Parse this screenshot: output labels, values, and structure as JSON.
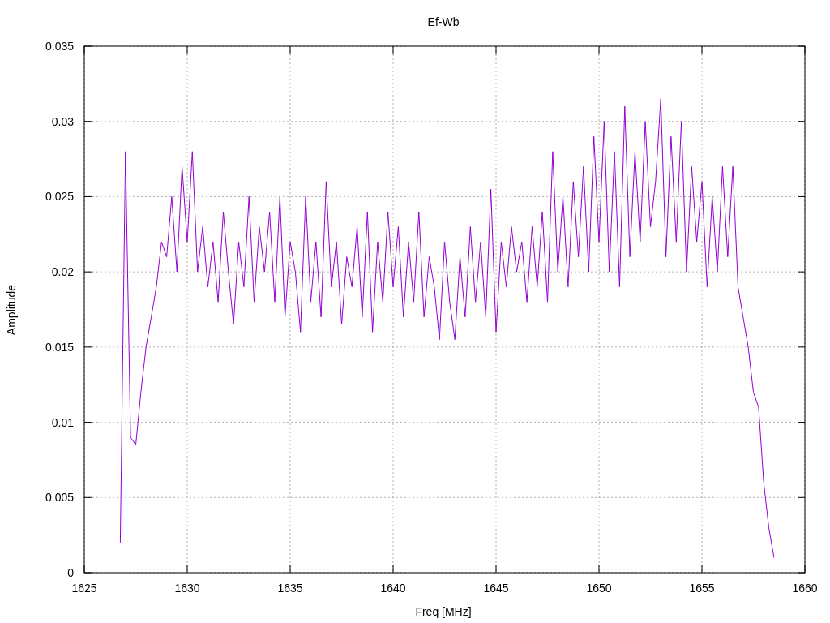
{
  "chart_data": {
    "type": "line",
    "title": "Ef-Wb",
    "xlabel": "Freq [MHz]",
    "ylabel": "Amplitude",
    "xlim": [
      1625,
      1660
    ],
    "ylim": [
      0,
      0.035
    ],
    "xticks": [
      1625,
      1630,
      1635,
      1640,
      1645,
      1650,
      1655,
      1660
    ],
    "yticks": [
      0,
      0.005,
      0.01,
      0.015,
      0.02,
      0.025,
      0.03,
      0.035
    ],
    "x": [
      1626.75,
      1627,
      1627.25,
      1627.5,
      1627.75,
      1628,
      1628.25,
      1628.5,
      1628.75,
      1629,
      1629.25,
      1629.5,
      1629.75,
      1630,
      1630.25,
      1630.5,
      1630.75,
      1631,
      1631.25,
      1631.5,
      1631.75,
      1632,
      1632.25,
      1632.5,
      1632.75,
      1633,
      1633.25,
      1633.5,
      1633.75,
      1634,
      1634.25,
      1634.5,
      1634.75,
      1635,
      1635.25,
      1635.5,
      1635.75,
      1636,
      1636.25,
      1636.5,
      1636.75,
      1637,
      1637.25,
      1637.5,
      1637.75,
      1638,
      1638.25,
      1638.5,
      1638.75,
      1639,
      1639.25,
      1639.5,
      1639.75,
      1640,
      1640.25,
      1640.5,
      1640.75,
      1641,
      1641.25,
      1641.5,
      1641.75,
      1642,
      1642.25,
      1642.5,
      1642.75,
      1643,
      1643.25,
      1643.5,
      1643.75,
      1644,
      1644.25,
      1644.5,
      1644.75,
      1645,
      1645.25,
      1645.5,
      1645.75,
      1646,
      1646.25,
      1646.5,
      1646.75,
      1647,
      1647.25,
      1647.5,
      1647.75,
      1648,
      1648.25,
      1648.5,
      1648.75,
      1649,
      1649.25,
      1649.5,
      1649.75,
      1650,
      1650.25,
      1650.5,
      1650.75,
      1651,
      1651.25,
      1651.5,
      1651.75,
      1652,
      1652.25,
      1652.5,
      1652.75,
      1653,
      1653.25,
      1653.5,
      1653.75,
      1654,
      1654.25,
      1654.5,
      1654.75,
      1655,
      1655.25,
      1655.5,
      1655.75,
      1656,
      1656.25,
      1656.5,
      1656.75,
      1657,
      1657.25,
      1657.5,
      1657.75,
      1658,
      1658.25,
      1658.5
    ],
    "grid": true,
    "series": [
      {
        "color": "#9400d3",
        "values": [
          0.002,
          0.028,
          0.009,
          0.0085,
          0.012,
          0.015,
          0.017,
          0.019,
          0.022,
          0.021,
          0.025,
          0.02,
          0.027,
          0.022,
          0.028,
          0.02,
          0.023,
          0.019,
          0.022,
          0.018,
          0.024,
          0.02,
          0.0165,
          0.022,
          0.019,
          0.025,
          0.018,
          0.023,
          0.02,
          0.024,
          0.018,
          0.025,
          0.017,
          0.022,
          0.02,
          0.016,
          0.025,
          0.018,
          0.022,
          0.017,
          0.026,
          0.019,
          0.022,
          0.0165,
          0.021,
          0.019,
          0.023,
          0.017,
          0.024,
          0.016,
          0.022,
          0.018,
          0.024,
          0.019,
          0.023,
          0.017,
          0.022,
          0.018,
          0.024,
          0.017,
          0.021,
          0.019,
          0.0155,
          0.022,
          0.018,
          0.0155,
          0.021,
          0.017,
          0.023,
          0.018,
          0.022,
          0.017,
          0.0255,
          0.016,
          0.022,
          0.019,
          0.023,
          0.02,
          0.022,
          0.018,
          0.023,
          0.019,
          0.024,
          0.018,
          0.028,
          0.02,
          0.025,
          0.019,
          0.026,
          0.021,
          0.027,
          0.02,
          0.029,
          0.022,
          0.03,
          0.02,
          0.028,
          0.019,
          0.031,
          0.021,
          0.028,
          0.022,
          0.03,
          0.023,
          0.026,
          0.0315,
          0.021,
          0.029,
          0.022,
          0.03,
          0.02,
          0.027,
          0.022,
          0.026,
          0.019,
          0.025,
          0.02,
          0.027,
          0.021,
          0.027,
          0.019,
          0.017,
          0.015,
          0.012,
          0.011,
          0.006,
          0.003,
          0.001
        ]
      }
    ]
  }
}
